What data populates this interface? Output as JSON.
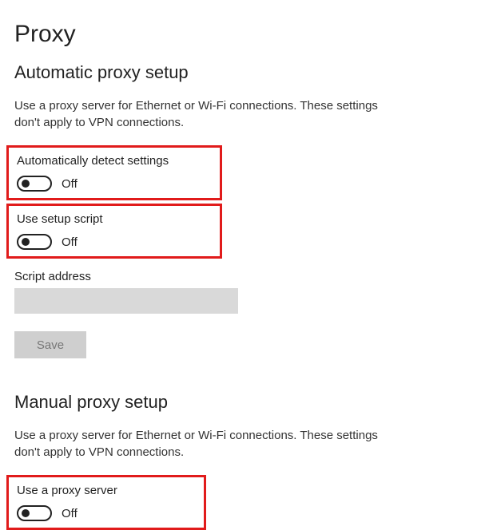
{
  "page": {
    "title": "Proxy"
  },
  "automatic": {
    "heading": "Automatic proxy setup",
    "description": "Use a proxy server for Ethernet or Wi-Fi connections. These settings don't apply to VPN connections.",
    "autoDetect": {
      "label": "Automatically detect settings",
      "state": "Off"
    },
    "setupScript": {
      "label": "Use setup script",
      "state": "Off"
    },
    "scriptAddress": {
      "label": "Script address",
      "value": ""
    },
    "saveLabel": "Save"
  },
  "manual": {
    "heading": "Manual proxy setup",
    "description": "Use a proxy server for Ethernet or Wi-Fi connections. These settings don't apply to VPN connections.",
    "useProxy": {
      "label": "Use a proxy server",
      "state": "Off"
    }
  }
}
